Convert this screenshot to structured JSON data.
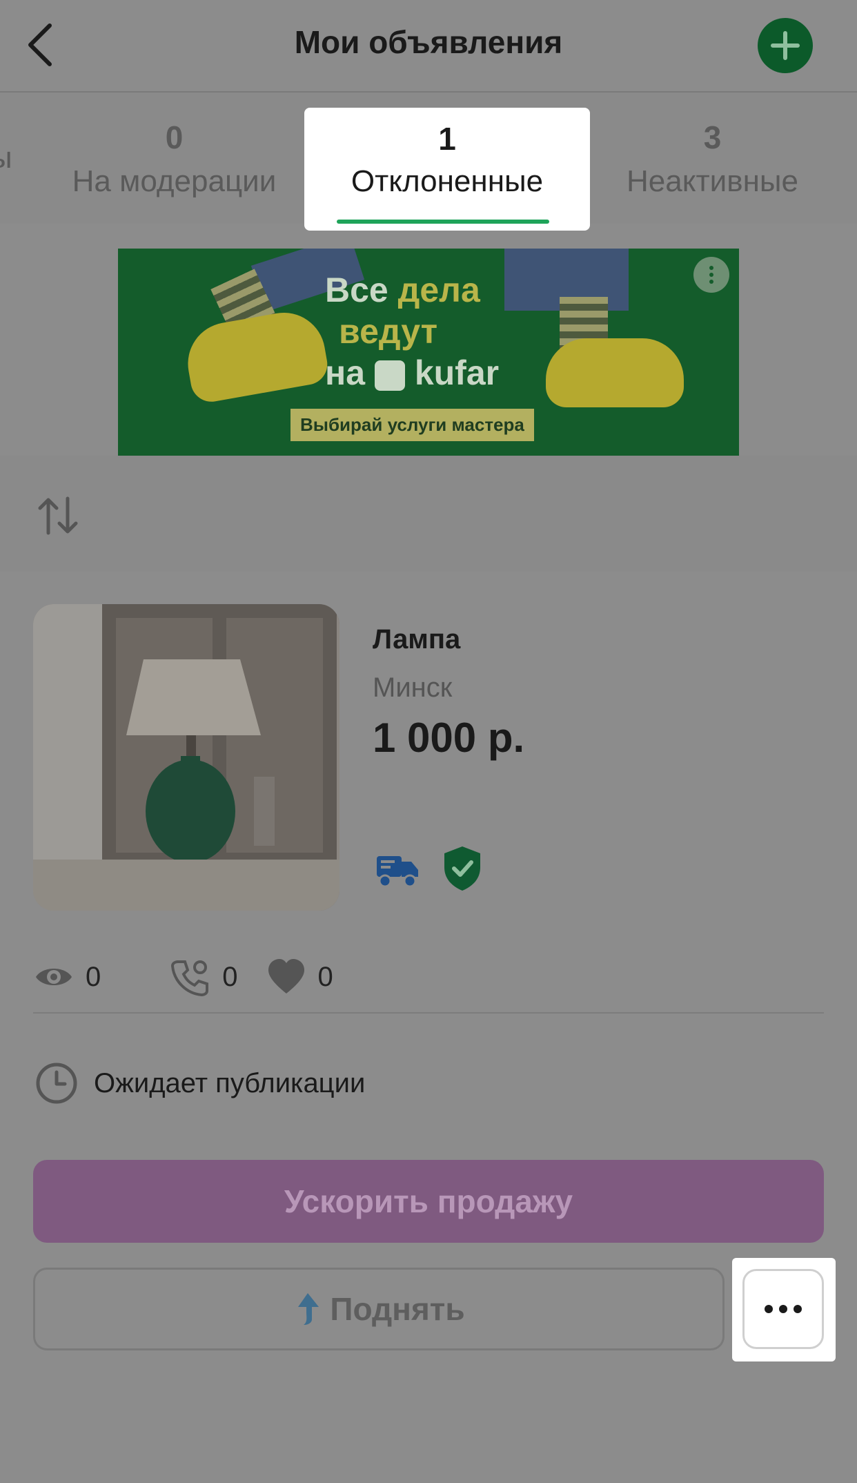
{
  "header": {
    "title": "Мои объявления",
    "back_icon": "chevron-left-icon",
    "add_icon": "plus-circle-icon"
  },
  "tabs": [
    {
      "count": "",
      "label": "ы"
    },
    {
      "count": "0",
      "label": "На модерации"
    },
    {
      "count": "1",
      "label": "Отклоненные",
      "active": true
    },
    {
      "count": "3",
      "label": "Неактивные"
    }
  ],
  "banner": {
    "line1": "Все",
    "line1_hl": "дела",
    "line2": "ведут",
    "line3": "на",
    "brand": "kufar",
    "cta": "Выбирай услуги мастера"
  },
  "sort": {
    "icon": "sort-arrows-icon"
  },
  "listing": {
    "title": "Лампа",
    "city": "Минск",
    "price": "1 000 р.",
    "badges": [
      "delivery-truck-icon",
      "verified-shield-icon"
    ],
    "stats": {
      "views": "0",
      "calls": "0",
      "favorites": "0"
    },
    "status": "Ожидает публикации",
    "boost_label": "Ускорить продажу",
    "raise_label": "Поднять"
  },
  "colors": {
    "accent_green": "#1fa45a",
    "boost_purple": "#7f5a80"
  }
}
